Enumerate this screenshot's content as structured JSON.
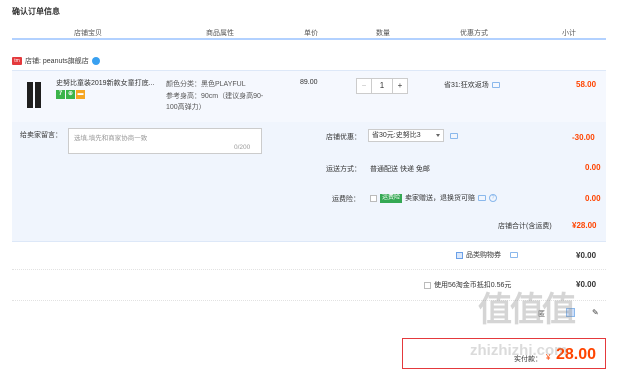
{
  "page": {
    "title": "确认订单信息"
  },
  "columns": [
    "店铺宝贝",
    "商品属性",
    "单价",
    "数量",
    "优惠方式",
    "小计"
  ],
  "shop": {
    "tag": "tm",
    "label": "店铺: peanuts旗舰店"
  },
  "item": {
    "name": "史努比童装2019新款女童打底...",
    "badges": [
      {
        "text": "7",
        "color": "#3bb44a"
      },
      {
        "text": "⊕",
        "color": "#3bb44a"
      },
      {
        "text": "▬",
        "color": "#f5a623"
      }
    ],
    "attr_color": "颜色分类：黑色PLAYFUL",
    "attr_height": "参考身高：90cm（建议身高90-",
    "attr_height2": "100高弹力）",
    "price": "89.00",
    "quantity": "1",
    "minus": "−",
    "plus": "+",
    "promotion": "省31:狂欢返场",
    "subtotal": "58.00"
  },
  "message": {
    "label": "给卖家留言：",
    "placeholder": "选填,填先和商家协商一致",
    "counter": "0/200"
  },
  "shop_discount": {
    "label": "店铺优惠：",
    "selected": "省30元:史努比3",
    "amount": "-30.00"
  },
  "shipping": {
    "label": "运送方式：",
    "value": "普通配送 快递 免邮",
    "amount": "0.00"
  },
  "insurance": {
    "label": "运费险：",
    "tag": "运费险",
    "text": "卖家赠送，退换货可赔",
    "amount": "0.00"
  },
  "shop_total": {
    "label": "店铺合计(含运费)",
    "amount": "¥28.00"
  },
  "coupon": {
    "label": "品类购物券",
    "amount": "¥0.00"
  },
  "coins": {
    "label": "使用56淘金币抵扣0.56元",
    "amount": "¥0.00"
  },
  "extra_fragment": "匿",
  "final": {
    "label": "实付款：",
    "currency": "¥",
    "amount": "28.00"
  },
  "watermark": {
    "site": "zhizhizhi.com",
    "glyphs": "值值值"
  },
  "colors": {
    "accent_red": "#ff4400",
    "border_blue": "#b2d1ff",
    "panel_bg": "#f0f5fd"
  }
}
